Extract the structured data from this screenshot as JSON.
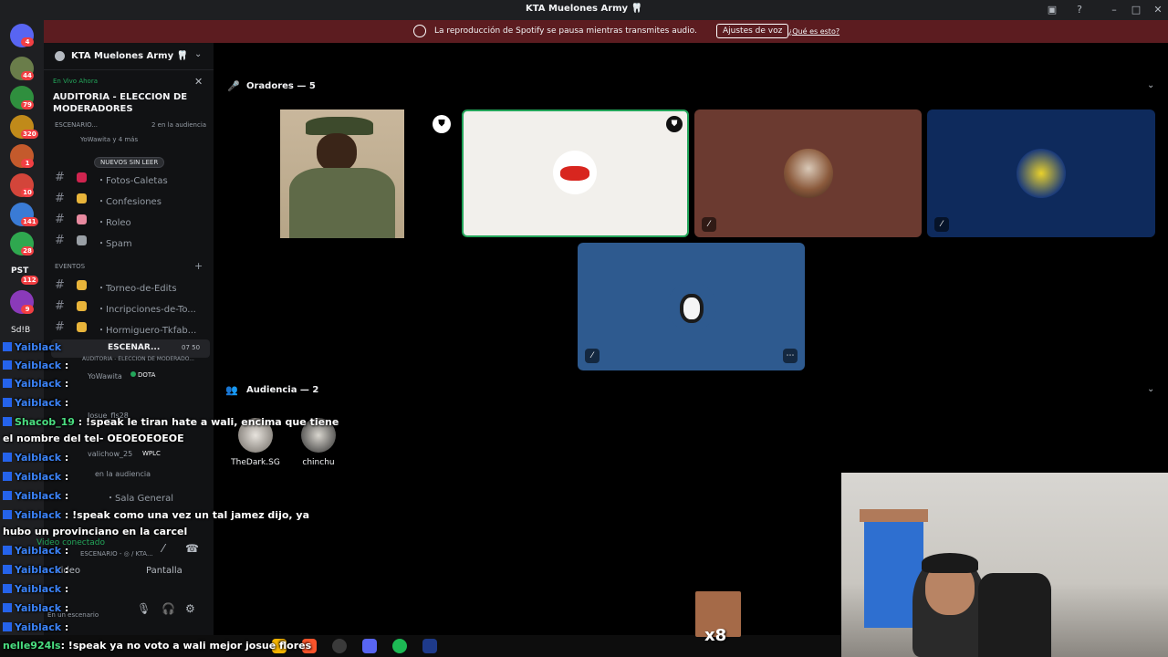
{
  "window": {
    "title": "KTA Muelones Army 🦷"
  },
  "banner": {
    "message": "La reproducción de Spotify se pausa mientras transmites audio.",
    "button": "Ajustes de voz",
    "link": "¿Qué es esto?"
  },
  "rail": {
    "badges": [
      "4",
      "44",
      "79",
      "320",
      "1",
      "10",
      "141",
      "28",
      "112",
      "9"
    ],
    "server_text_1": "PST",
    "server_text_2": "Sd!B"
  },
  "sidebar": {
    "guild_name": "KTA Muelones Army 🦷",
    "live_label": "En Vivo Ahora",
    "live_title": "AUDITORIA - ELECCION DE MODERADORES",
    "live_sub": "ESCENARIO...",
    "live_audience": "2 en la audiencia",
    "live_who": "YoWawita y 4 más",
    "unread_pill": "NUEVOS SIN LEER",
    "channels": [
      {
        "label": "・Fotos-Caletas"
      },
      {
        "label": "・Confesiones"
      },
      {
        "label": "・Roleo"
      },
      {
        "label": "・Spam"
      }
    ],
    "category": "EVENTOS",
    "event_channels": [
      {
        "label": "・Torneo-de-Edits"
      },
      {
        "label": "・Incripciones-de-To..."
      },
      {
        "label": "・Hormiguero-Tkfab..."
      }
    ],
    "stage_channel": "ESCENAR...",
    "stage_counts": "07   50",
    "stage_sub": "AUDITORIA - ELECCION DE MODERADO...",
    "member_1": "YoWawita",
    "member_1_activity": "DOTA",
    "member_2": "Josue_fls28",
    "member_3": "valichow_25",
    "member_3_activity": "WPLC",
    "audience_label": "en la audiencia",
    "sala": "・Sala General",
    "voice_status": "Video conectado",
    "voice_sub": "ESCENARIO - ◎ / KTA...",
    "video_button": "Video",
    "screen_button": "Pantalla",
    "stage_note": "En un escenario"
  },
  "stage": {
    "speakers_header": "Oradores — 5",
    "audience_header": "Audiencia — 2",
    "audience": [
      {
        "name": "TheDark.SG"
      },
      {
        "name": "chinchu"
      }
    ]
  },
  "chat": [
    {
      "user": "Yaiblack",
      "msg": ""
    },
    {
      "user": "Yaiblack",
      "msg": ":"
    },
    {
      "user": "Yaiblack",
      "msg": ":"
    },
    {
      "user": "Yaiblack",
      "msg": ":"
    },
    {
      "user": "Shacob_19",
      "msg": ": !speak le tiran hate a wali, encima que tiene"
    },
    {
      "user": "",
      "msg": "el nombre del tel- OEOEOEOEOE"
    },
    {
      "user": "Yaiblack",
      "msg": ":"
    },
    {
      "user": "Yaiblack",
      "msg": ":"
    },
    {
      "user": "Yaiblack",
      "msg": ":"
    },
    {
      "user": "Yaiblack",
      "msg": ": !speak como una vez un tal jamez dijo, ya"
    },
    {
      "user": "",
      "msg": "hubo un provinciano en la carcel"
    },
    {
      "user": "Yaiblack",
      "msg": ":"
    },
    {
      "user": "Yaiblack",
      "msg": ":"
    },
    {
      "user": "Yaiblack",
      "msg": ":"
    },
    {
      "user": "Yaiblack",
      "msg": ":"
    },
    {
      "user": "Yaiblack",
      "msg": ":"
    },
    {
      "user": "nelle924ls",
      "msg": ": !speak ya no voto a wali mejor josue flores"
    }
  ],
  "emote": {
    "multiplier": "x8"
  },
  "colors": {
    "discord_dark": "#1e1f22",
    "sidebar": "#111214",
    "banner": "#5c1c20",
    "speaking_border": "#23a55a",
    "tile_brown": "#6b3a30",
    "tile_navy": "#0e2a5c",
    "tile_blue": "#2e5a8f"
  }
}
